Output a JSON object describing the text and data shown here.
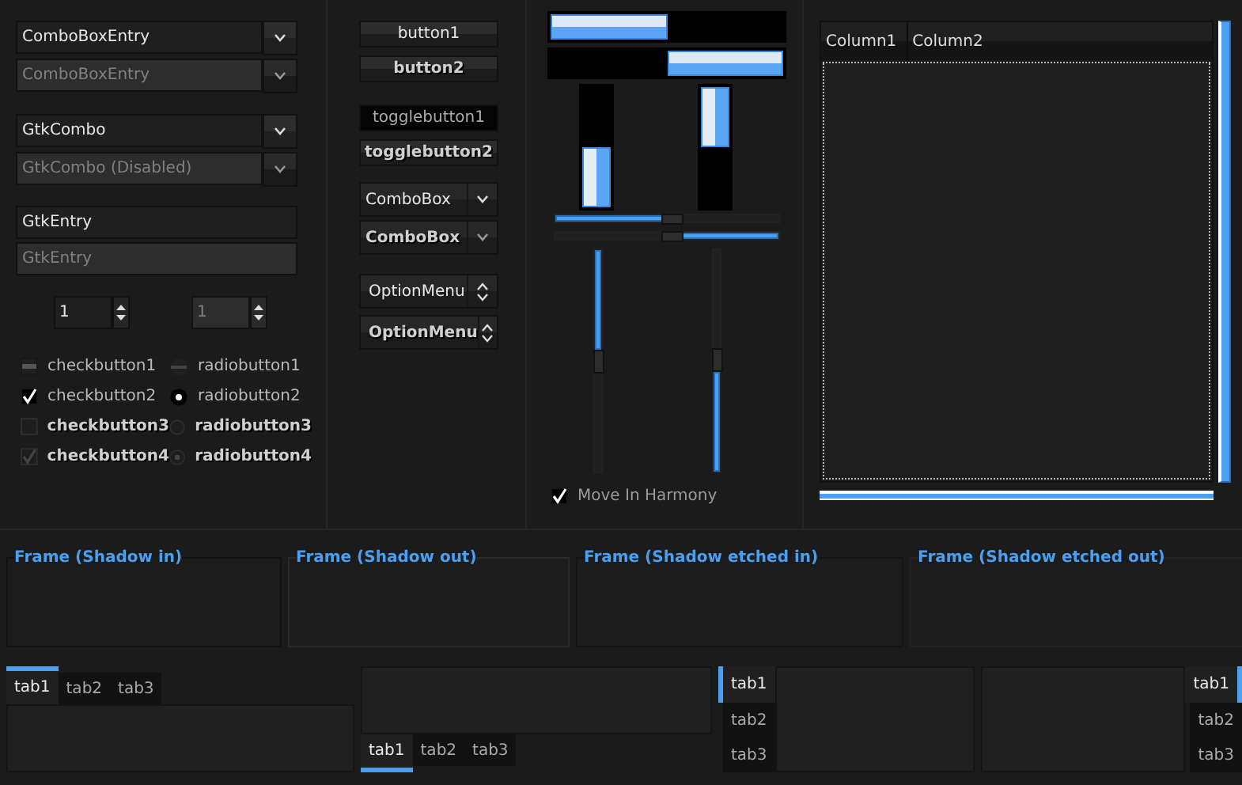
{
  "combo_box_entries": [
    {
      "value": "ComboBoxEntry",
      "disabled": false
    },
    {
      "value": "ComboBoxEntry",
      "disabled": true
    }
  ],
  "gtk_combos": [
    {
      "value": "GtkCombo",
      "disabled": false
    },
    {
      "value": "GtkCombo (Disabled)",
      "disabled": true
    }
  ],
  "entries": [
    {
      "value": "GtkEntry",
      "disabled": false
    },
    {
      "value": "GtkEntry",
      "disabled": true
    }
  ],
  "spin_buttons": [
    {
      "value": "1",
      "disabled": false
    },
    {
      "value": "1",
      "disabled": true
    }
  ],
  "check_buttons": [
    {
      "label": "checkbutton1",
      "checked": false,
      "inconsistent": true,
      "disabled": false
    },
    {
      "label": "checkbutton2",
      "checked": true,
      "inconsistent": false,
      "disabled": false
    },
    {
      "label": "checkbutton3",
      "checked": false,
      "inconsistent": false,
      "disabled": true
    },
    {
      "label": "checkbutton4",
      "checked": true,
      "inconsistent": false,
      "disabled": true
    }
  ],
  "radio_buttons": [
    {
      "label": "radiobutton1",
      "selected": false,
      "inconsistent": true,
      "disabled": false
    },
    {
      "label": "radiobutton2",
      "selected": true,
      "inconsistent": false,
      "disabled": false
    },
    {
      "label": "radiobutton3",
      "selected": false,
      "inconsistent": false,
      "disabled": true
    },
    {
      "label": "radiobutton4",
      "selected": true,
      "inconsistent": false,
      "disabled": true
    }
  ],
  "buttons": [
    {
      "label": "button1",
      "disabled": false
    },
    {
      "label": "button2",
      "disabled": true
    }
  ],
  "toggle_buttons": [
    {
      "label": "togglebutton1",
      "on": true,
      "disabled": false
    },
    {
      "label": "togglebutton2",
      "on": false,
      "disabled": true
    }
  ],
  "combo_boxes": [
    {
      "value": "ComboBox",
      "disabled": false
    },
    {
      "value": "ComboBox",
      "disabled": true
    }
  ],
  "option_menus": [
    {
      "value": "OptionMenu",
      "disabled": false
    },
    {
      "value": "OptionMenu",
      "disabled": true
    }
  ],
  "progress_bars": [
    {
      "kind": "ltr",
      "level": 0.5
    },
    {
      "kind": "rtl",
      "level": 0.5
    }
  ],
  "vertical_progress_bars": [
    {
      "kind": "btt",
      "level": 0.5
    },
    {
      "kind": "ttb",
      "level": 0.5
    }
  ],
  "horizontal_scales": [
    {
      "inverted": false,
      "level": 0.5
    },
    {
      "inverted": true,
      "level": 0.5
    }
  ],
  "vertical_scales": [
    {
      "inverted": false,
      "level": 0.45
    },
    {
      "inverted": true,
      "level": 0.45
    }
  ],
  "move_in_harmony": {
    "label": "Move In Harmony",
    "checked": true
  },
  "tree_view": {
    "columns": [
      "Column1",
      "Column2"
    ]
  },
  "frames": [
    {
      "label": "Frame (Shadow in)",
      "kind": "in"
    },
    {
      "label": "Frame (Shadow out)",
      "kind": "out"
    },
    {
      "label": "Frame (Shadow etched in)",
      "kind": "etched_in"
    },
    {
      "label": "Frame (Shadow etched out)",
      "kind": "etched_out"
    }
  ],
  "notebooks": [
    {
      "kind": "top",
      "tabs": [
        {
          "label": "tab1",
          "selected": true
        },
        {
          "label": "tab2",
          "selected": false
        },
        {
          "label": "tab3",
          "selected": false
        }
      ]
    },
    {
      "kind": "bottom",
      "tabs": [
        {
          "label": "tab1",
          "selected": true
        },
        {
          "label": "tab2",
          "selected": false
        },
        {
          "label": "tab3",
          "selected": false
        }
      ]
    },
    {
      "kind": "left",
      "tabs": [
        {
          "label": "tab1",
          "selected": true
        },
        {
          "label": "tab2",
          "selected": false
        },
        {
          "label": "tab3",
          "selected": false
        }
      ]
    },
    {
      "kind": "right",
      "tabs": [
        {
          "label": "tab1",
          "selected": true
        },
        {
          "label": "tab2",
          "selected": false
        },
        {
          "label": "tab3",
          "selected": false
        }
      ]
    }
  ]
}
